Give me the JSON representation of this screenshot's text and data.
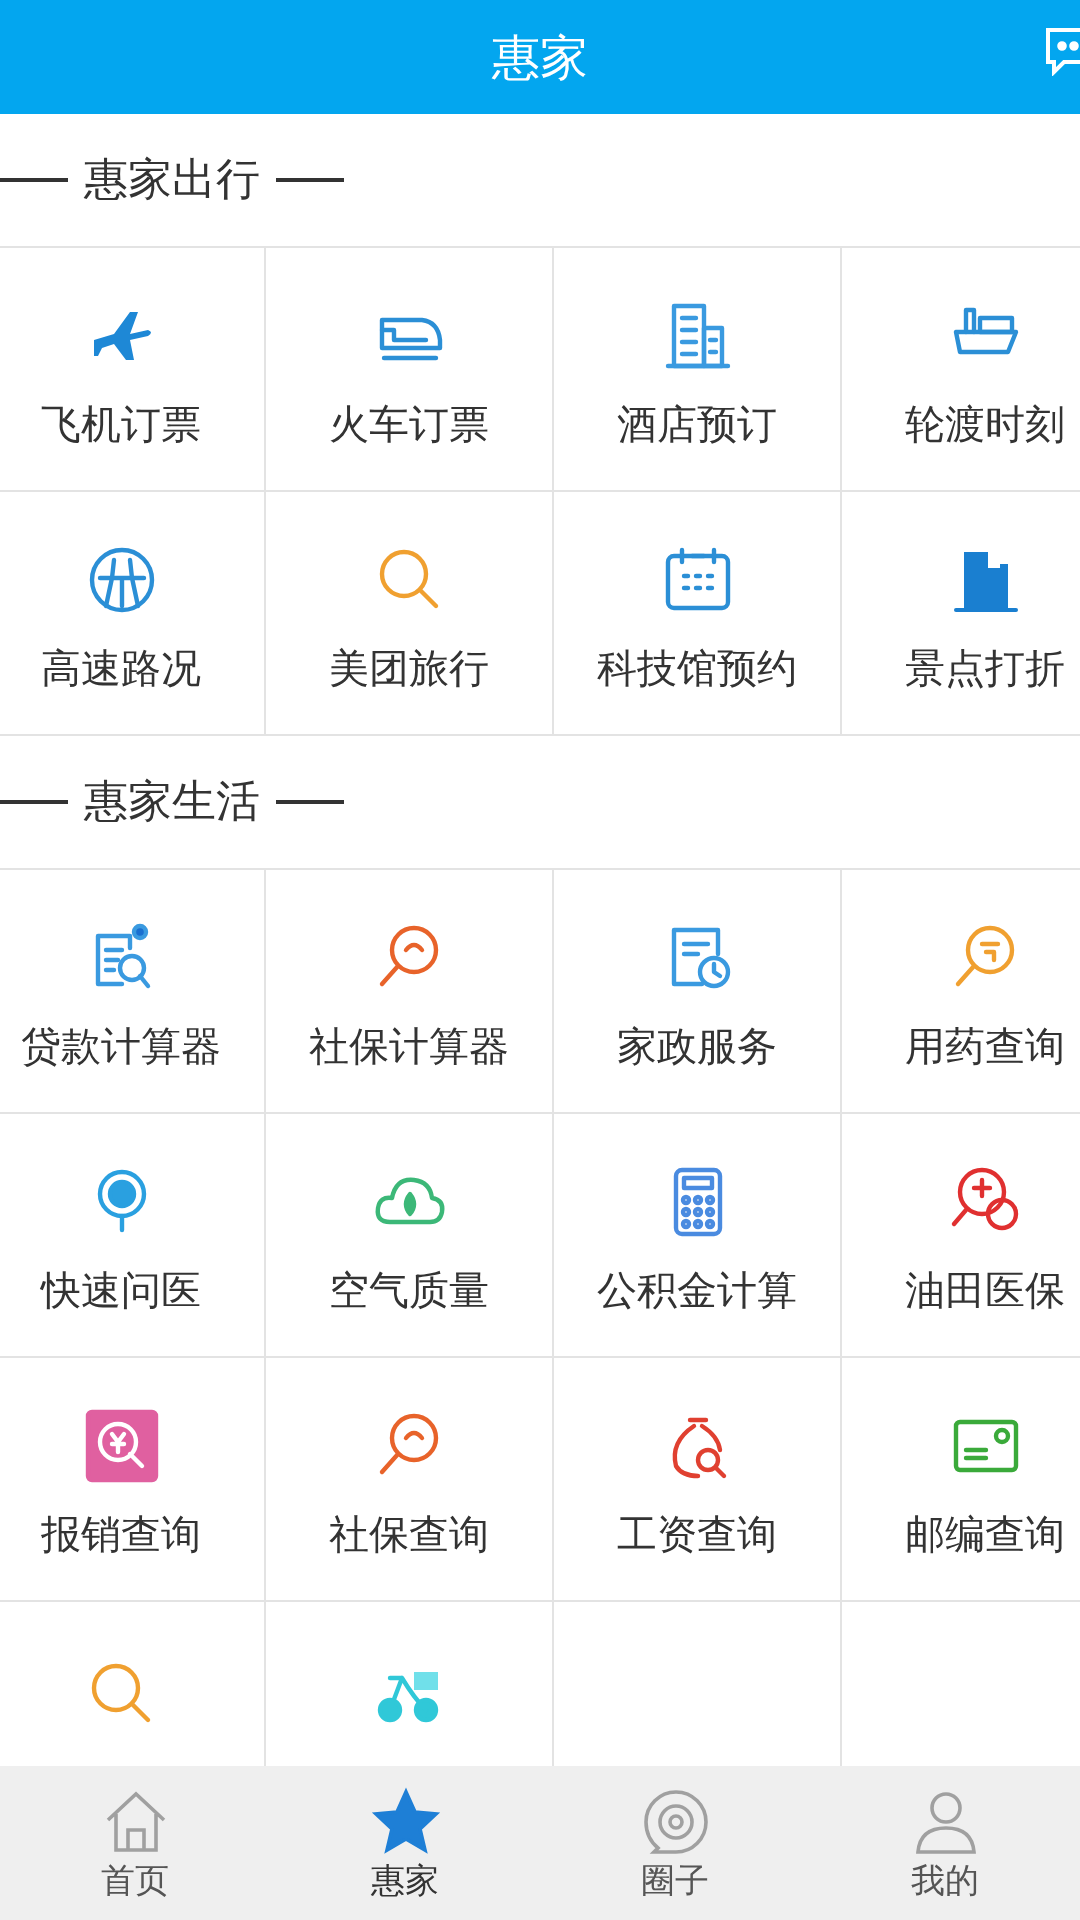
{
  "header": {
    "title": "惠家"
  },
  "sections": [
    {
      "title": "惠家出行",
      "items": [
        {
          "kind": "tile",
          "label": "飞机订票"
        },
        {
          "kind": "tile",
          "label": "火车订票"
        },
        {
          "kind": "tile",
          "label": "酒店预订"
        },
        {
          "kind": "tile",
          "label": "轮渡时刻"
        },
        {
          "kind": "tile",
          "label": "高速路况"
        },
        {
          "kind": "tile",
          "label": "美团旅行"
        },
        {
          "kind": "tile",
          "label": "科技馆预约"
        },
        {
          "kind": "tile",
          "label": "景点打折"
        }
      ]
    },
    {
      "title": "惠家生活",
      "items": [
        {
          "kind": "tile",
          "label": "贷款计算器"
        },
        {
          "kind": "tile",
          "label": "社保计算器"
        },
        {
          "kind": "tile",
          "label": "家政服务"
        },
        {
          "kind": "tile",
          "label": "用药查询"
        },
        {
          "kind": "tile",
          "label": "快速问医"
        },
        {
          "kind": "tile",
          "label": "空气质量"
        },
        {
          "kind": "tile",
          "label": "公积金计算"
        },
        {
          "kind": "tile",
          "label": "油田医保"
        },
        {
          "kind": "tile",
          "label": "报销查询"
        },
        {
          "kind": "tile",
          "label": "社保查询"
        },
        {
          "kind": "tile",
          "label": "工资查询"
        },
        {
          "kind": "tile",
          "label": "邮编查询"
        },
        {
          "kind": "cut_tile"
        },
        {
          "kind": "cut_tile"
        }
      ]
    }
  ],
  "tabs": [
    {
      "label": "首页",
      "selected": false
    },
    {
      "label": "惠家",
      "selected": true
    },
    {
      "label": "圈子",
      "selected": false
    },
    {
      "label": "我的",
      "selected": false
    }
  ]
}
